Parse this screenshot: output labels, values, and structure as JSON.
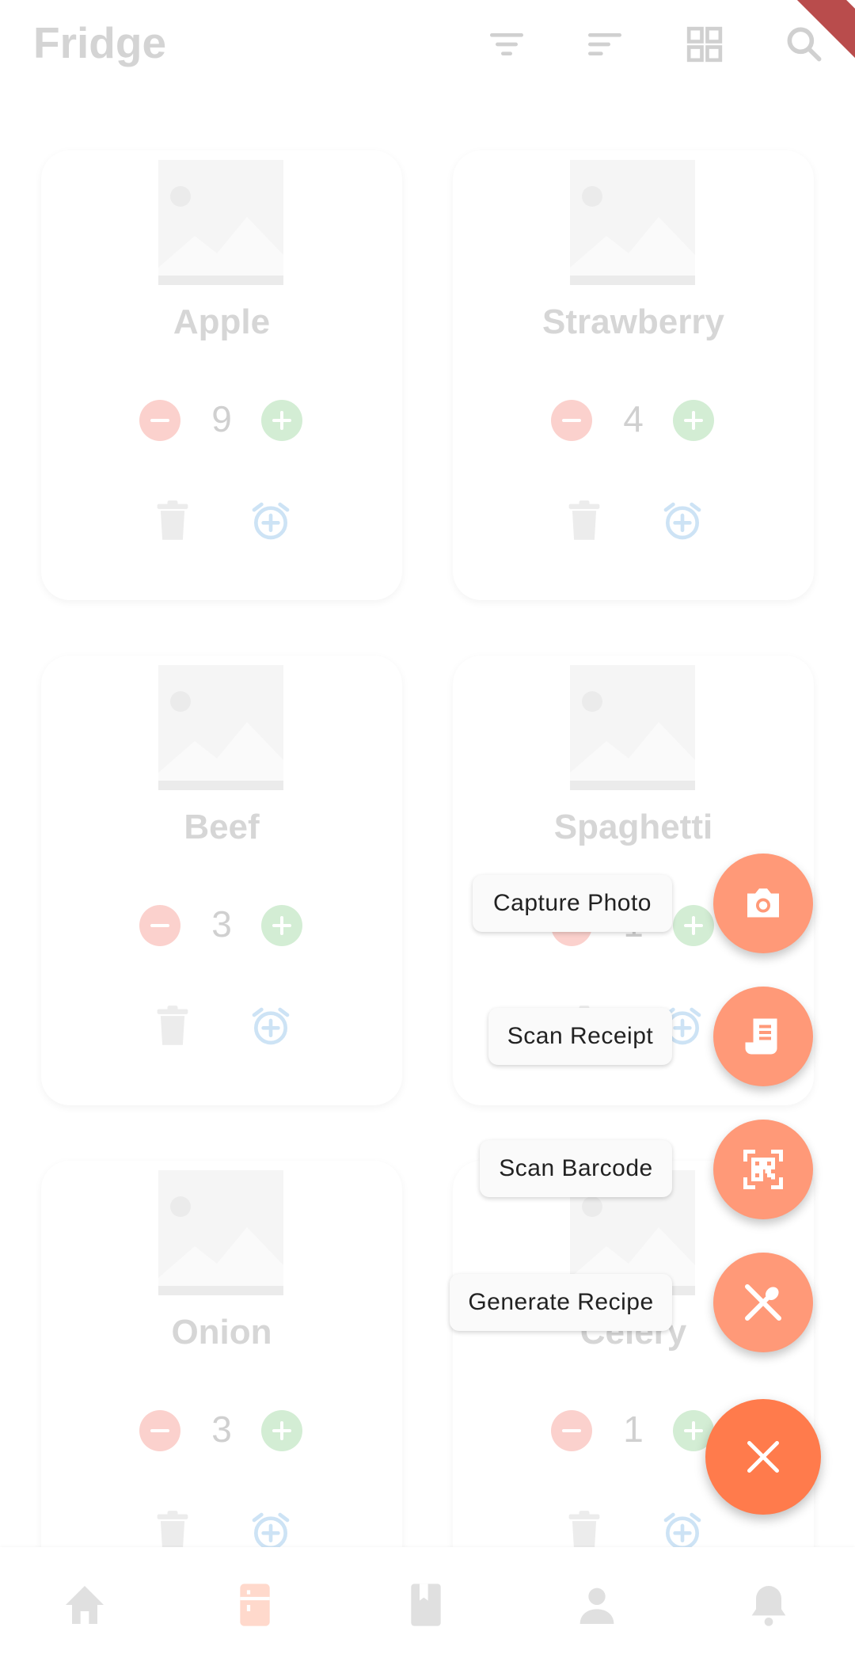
{
  "header": {
    "title": "Fridge",
    "icons": [
      "filter-icon",
      "sort-icon",
      "grid-view-icon",
      "search-icon"
    ]
  },
  "items": [
    {
      "name": "Apple",
      "quantity": "9"
    },
    {
      "name": "Strawberry",
      "quantity": "4"
    },
    {
      "name": "Beef",
      "quantity": "3"
    },
    {
      "name": "Spaghetti",
      "quantity": "1"
    },
    {
      "name": "Onion",
      "quantity": "3"
    },
    {
      "name": "Celery",
      "quantity": "1"
    }
  ],
  "speed_dial": {
    "actions": [
      {
        "label": "Capture Photo",
        "icon": "camera-icon"
      },
      {
        "label": "Scan Receipt",
        "icon": "receipt-icon"
      },
      {
        "label": "Scan Barcode",
        "icon": "barcode-icon"
      },
      {
        "label": "Generate Recipe",
        "icon": "utensils-icon"
      }
    ],
    "close_icon": "close-icon"
  },
  "bottom_nav": {
    "items": [
      "home-icon",
      "fridge-icon",
      "book-icon",
      "person-icon",
      "bell-icon"
    ],
    "active_index": 1
  },
  "colors": {
    "accent": "#ff7b4c",
    "fab": "#ff9978",
    "minus": "#fbd1cd",
    "plus": "#d3edd4",
    "alarm": "#cde3f5"
  }
}
